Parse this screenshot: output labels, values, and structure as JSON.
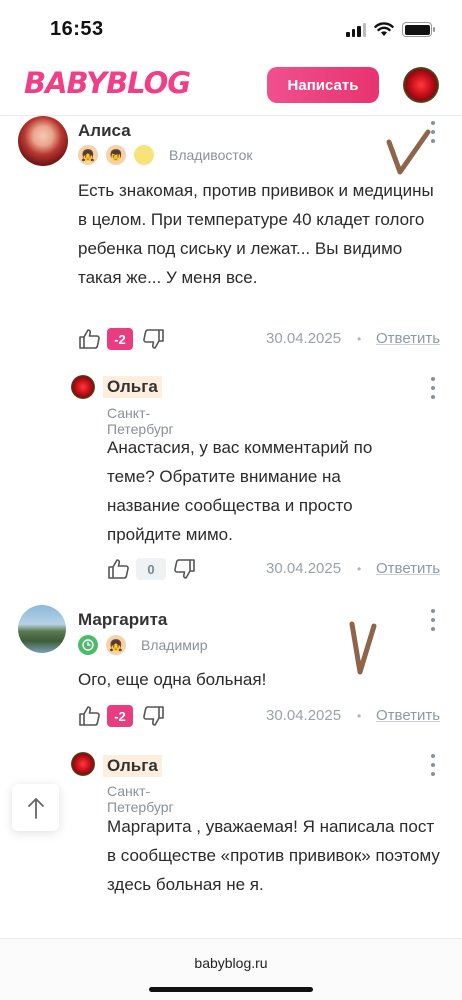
{
  "status_bar": {
    "time": "16:53"
  },
  "header": {
    "logo": "BABYBLOG",
    "write_button": "Написать"
  },
  "comments": [
    {
      "author": "Алиса",
      "city": "Владивосток",
      "text": "Есть знакомая, против прививок и медицины в целом. При температуре 40 кладет голого ребенка под сиську и лежат... Вы видимо такая же... У меня все.",
      "score": "-2",
      "date": "30.04.2025",
      "reply": "Ответить"
    },
    {
      "author": "Ольга",
      "city": "Санкт-Петербург",
      "mention": "Анастасия",
      "text": ", у вас комментарий по теме? Обратите внимание на название сообщества и просто пройдите мимо.",
      "score": "0",
      "date": "30.04.2025",
      "reply": "Ответить"
    },
    {
      "author": "Маргарита",
      "city": "Владимир",
      "text": "Ого, еще одна больная!",
      "score": "-2",
      "date": "30.04.2025",
      "reply": "Ответить"
    },
    {
      "author": "Ольга",
      "city": "Санкт-Петербург",
      "mention": "Маргарита",
      "text": " , уважаемая! Я написала пост в сообществе «против прививок» поэтому здесь больная не я."
    }
  ],
  "footer": {
    "url": "babyblog.ru"
  },
  "colors": {
    "brand": "#ef3f87",
    "negative_score": "#e83d80",
    "name_highlight": "#fdeedd"
  },
  "icons": [
    "signal-icon",
    "wifi-icon",
    "battery-icon",
    "thumb-up-icon",
    "thumb-down-icon",
    "more-dots-icon",
    "arrow-up-icon",
    "checkmark-sticker"
  ]
}
